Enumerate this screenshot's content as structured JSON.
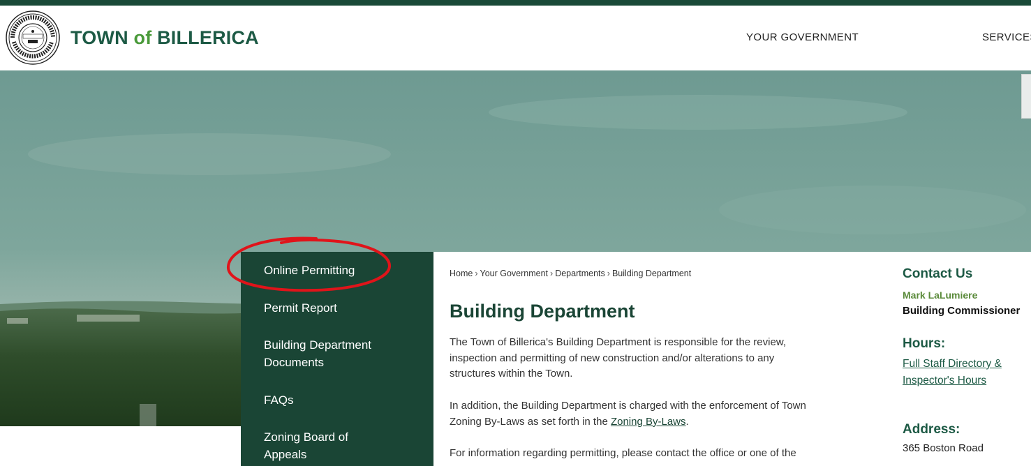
{
  "header": {
    "title_part1": "TOWN",
    "title_of": "of",
    "title_part2": "BILLERICA",
    "seal_text": [
      "TOWN OF BILLERICA",
      "INCORPORATED",
      "1655",
      "MASSACHUSETTS"
    ],
    "nav": [
      "YOUR GOVERNMENT",
      "SERVICES"
    ]
  },
  "sidebar": {
    "items": [
      {
        "label": "Online Permitting"
      },
      {
        "label": "Permit Report"
      },
      {
        "label_line1": "Building Department",
        "label_line2": "Documents"
      },
      {
        "label": "FAQs"
      },
      {
        "label_line1": "Zoning Board of",
        "label_line2": "Appeals"
      }
    ]
  },
  "breadcrumb": [
    "Home",
    "Your Government",
    "Departments",
    "Building Department"
  ],
  "breadcrumb_sep": "›",
  "main": {
    "title": "Building Department",
    "p1_lines": [
      "The Town of Billerica's Building Department is responsible for the review,",
      "inspection and permitting of new construction and/or alterations to any",
      "structures within the Town."
    ],
    "p2_line1": "In addition, the Building Department is charged with the enforcement of Town",
    "p2_line2_pre": "Zoning By-Laws as set forth in the ",
    "p2_link": "Zoning By-Laws",
    "p2_line2_post": ".",
    "p3_line1": "For information regarding permitting, please contact the office or one of the"
  },
  "contact": {
    "heading": "Contact Us",
    "name": "Mark LaLumiere",
    "role": "Building Commissioner",
    "hours_heading": "Hours:",
    "hours_link_line1": "Full Staff Directory &",
    "hours_link_line2": "Inspector's Hours",
    "address_heading": "Address:",
    "address_line1": "365 Boston Road"
  },
  "colors": {
    "brand_dark_green": "#1a4535",
    "brand_green": "#1d5a45",
    "accent_light_green": "#4a9a3a",
    "annotation_red": "#e0141a"
  }
}
